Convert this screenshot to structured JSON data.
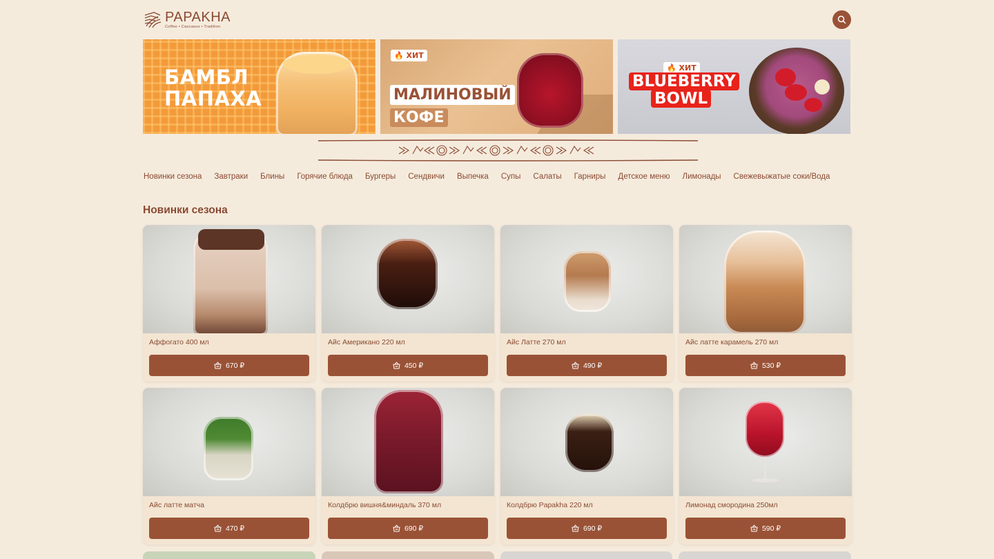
{
  "brand": {
    "name": "PAPAKHA",
    "tagline": "Coffee • Caucasus • Tradition"
  },
  "banners": [
    {
      "title_line1": "БАМБЛ",
      "title_line2": "ПАПАХА"
    },
    {
      "badge": "🔥 ХИТ",
      "title_line1": "МАЛИНОВЫЙ",
      "title_line2": "КОФЕ"
    },
    {
      "badge": "🔥 ХИТ",
      "title_line1": "BLUEBERRY",
      "title_line2": "BOWL"
    }
  ],
  "nav": [
    "Новинки сезона",
    "Завтраки",
    "Блины",
    "Горячие блюда",
    "Бургеры",
    "Сендвичи",
    "Выпечка",
    "Супы",
    "Салаты",
    "Гарниры",
    "Детское меню",
    "Лимонады",
    "Свежевыжатые соки/Вода"
  ],
  "section": {
    "title": "Новинки сезона"
  },
  "products": [
    {
      "name": "Аффогато 400 мл",
      "price": "670 ₽"
    },
    {
      "name": "Айс Американо 220 мл",
      "price": "450 ₽"
    },
    {
      "name": "Айс Латте 270 мл",
      "price": "490 ₽"
    },
    {
      "name": "Айс латте карамель 270 мл",
      "price": "530 ₽"
    },
    {
      "name": "Айс латте матча",
      "price": "470 ₽"
    },
    {
      "name": "Колдбрю вишня&миндаль 370 мл",
      "price": "690 ₽"
    },
    {
      "name": "Колдбрю Papakha 220 мл",
      "price": "690 ₽"
    },
    {
      "name": "Лимонад смородина 250мл",
      "price": "590 ₽"
    }
  ],
  "colors": {
    "background": "#f5ebdd",
    "accent": "#9a5236",
    "text": "#8a4a32"
  },
  "icons": {
    "search": "search-icon",
    "cart": "basket-icon"
  }
}
